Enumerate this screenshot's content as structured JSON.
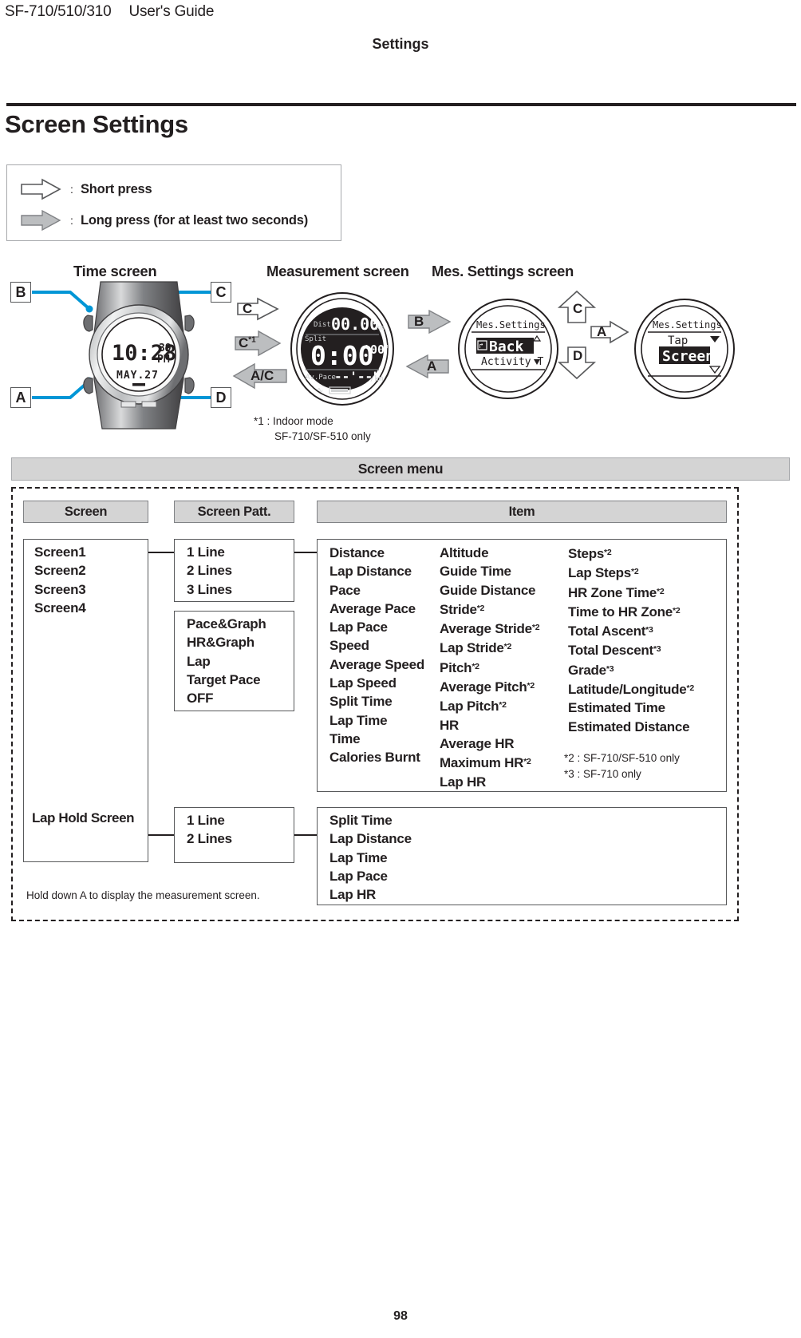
{
  "header": {
    "model": "SF-710/510/310",
    "guide": "User's Guide",
    "section": "Settings"
  },
  "page_title": "Screen Settings",
  "page_number": "98",
  "legend": {
    "short_icon": "hollow-right-arrow-icon",
    "short_colon": ":",
    "short_label": "Short press",
    "long_icon": "filled-right-arrow-icon",
    "long_colon": ":",
    "long_label": "Long press (for at least two seconds)"
  },
  "diagram": {
    "captions": {
      "time": "Time screen",
      "measurement": "Measurement screen",
      "mes_settings": "Mes. Settings screen"
    },
    "watch_buttons": {
      "top_left": "B",
      "top_right": "C",
      "bottom_left": "A",
      "bottom_right": "D"
    },
    "time_face": {
      "time": "10:28",
      "seconds": "39",
      "ampm": "PM",
      "date": "MAY. 27"
    },
    "measurement_face": {
      "dist_label": "Dist.",
      "dist_value": "00.00",
      "dist_unit": "km",
      "split_label": "Split",
      "split_value": "0:00",
      "split_sub": "'00\"",
      "pace_label": "Av.Pace",
      "pace_value": "--'--\"",
      "pace_unit": "/km"
    },
    "settings_face_1": {
      "title": "Mes.Settings",
      "selected": "Back",
      "next": "Activity Ty"
    },
    "settings_face_2": {
      "title": "Mes.Settings",
      "above": "Tap",
      "selected": "Screen"
    },
    "arrows": {
      "c_short": "C",
      "c_long": "C",
      "c_long_note": "*1",
      "ac_long": "A/C",
      "b_long": "B",
      "a_long": "A",
      "c_up": "C",
      "d_down": "D",
      "a_short": "A"
    },
    "footnote": {
      "line1": "*1 : Indoor mode",
      "line2": "SF-710/SF-510 only"
    }
  },
  "menu": {
    "band_title": "Screen menu",
    "headers": {
      "screen": "Screen",
      "screen_patt": "Screen Patt.",
      "item": "Item"
    },
    "screen_list": [
      "Screen1",
      "Screen2",
      "Screen3",
      "Screen4"
    ],
    "lap_hold_label": "Lap Hold Screen",
    "patt_lines": [
      "1 Line",
      "2 Lines",
      "3 Lines"
    ],
    "patt_pace": [
      "Pace&Graph",
      "HR&Graph",
      "Lap",
      "Target Pace",
      "OFF"
    ],
    "patt_lap_hold": [
      "1 Line",
      "2 Lines"
    ],
    "item_col1": [
      {
        "label": "Distance",
        "note": ""
      },
      {
        "label": "Lap Distance",
        "note": ""
      },
      {
        "label": "Pace",
        "note": ""
      },
      {
        "label": "Average Pace",
        "note": ""
      },
      {
        "label": "Lap Pace",
        "note": ""
      },
      {
        "label": "Speed",
        "note": ""
      },
      {
        "label": "Average Speed",
        "note": ""
      },
      {
        "label": "Lap Speed",
        "note": ""
      },
      {
        "label": "Split Time",
        "note": ""
      },
      {
        "label": "Lap Time",
        "note": ""
      },
      {
        "label": "Time",
        "note": ""
      },
      {
        "label": "Calories Burnt",
        "note": ""
      }
    ],
    "item_col2": [
      {
        "label": "Altitude",
        "note": ""
      },
      {
        "label": "Guide Time",
        "note": ""
      },
      {
        "label": "Guide Distance",
        "note": ""
      },
      {
        "label": "Stride",
        "note": "*2"
      },
      {
        "label": "Average Stride",
        "note": "*2"
      },
      {
        "label": "Lap Stride",
        "note": "*2"
      },
      {
        "label": "Pitch",
        "note": "*2"
      },
      {
        "label": "Average Pitch",
        "note": "*2"
      },
      {
        "label": "Lap Pitch",
        "note": "*2"
      },
      {
        "label": "HR",
        "note": ""
      },
      {
        "label": "Average HR",
        "note": ""
      },
      {
        "label": "Maximum HR",
        "note": "*2"
      },
      {
        "label": "Lap HR",
        "note": ""
      }
    ],
    "item_col3": [
      {
        "label": "Steps",
        "note": "*2"
      },
      {
        "label": "Lap Steps",
        "note": "*2"
      },
      {
        "label": "HR Zone Time",
        "note": "*2"
      },
      {
        "label": "Time to HR Zone",
        "note": "*2"
      },
      {
        "label": "Total Ascent",
        "note": "*3"
      },
      {
        "label": "Total Descent",
        "note": "*3"
      },
      {
        "label": "Grade",
        "note": "*3"
      },
      {
        "label": "Latitude/Longitude",
        "note": "*2"
      },
      {
        "label": "Estimated Time",
        "note": ""
      },
      {
        "label": "Estimated Distance",
        "note": ""
      }
    ],
    "item_lap_hold": [
      "Split Time",
      "Lap Distance",
      "Lap Time",
      "Lap Pace",
      "Lap HR"
    ],
    "item_footnotes": {
      "f2": "*2 : SF-710/SF-510 only",
      "f3": "*3 : SF-710 only"
    },
    "hold_note": "Hold down A to display the measurement screen."
  },
  "colors": {
    "ink": "#231f20",
    "band": "#d4d4d4",
    "lead": "#0096d6",
    "arrow_fill": "#bcbec0"
  }
}
